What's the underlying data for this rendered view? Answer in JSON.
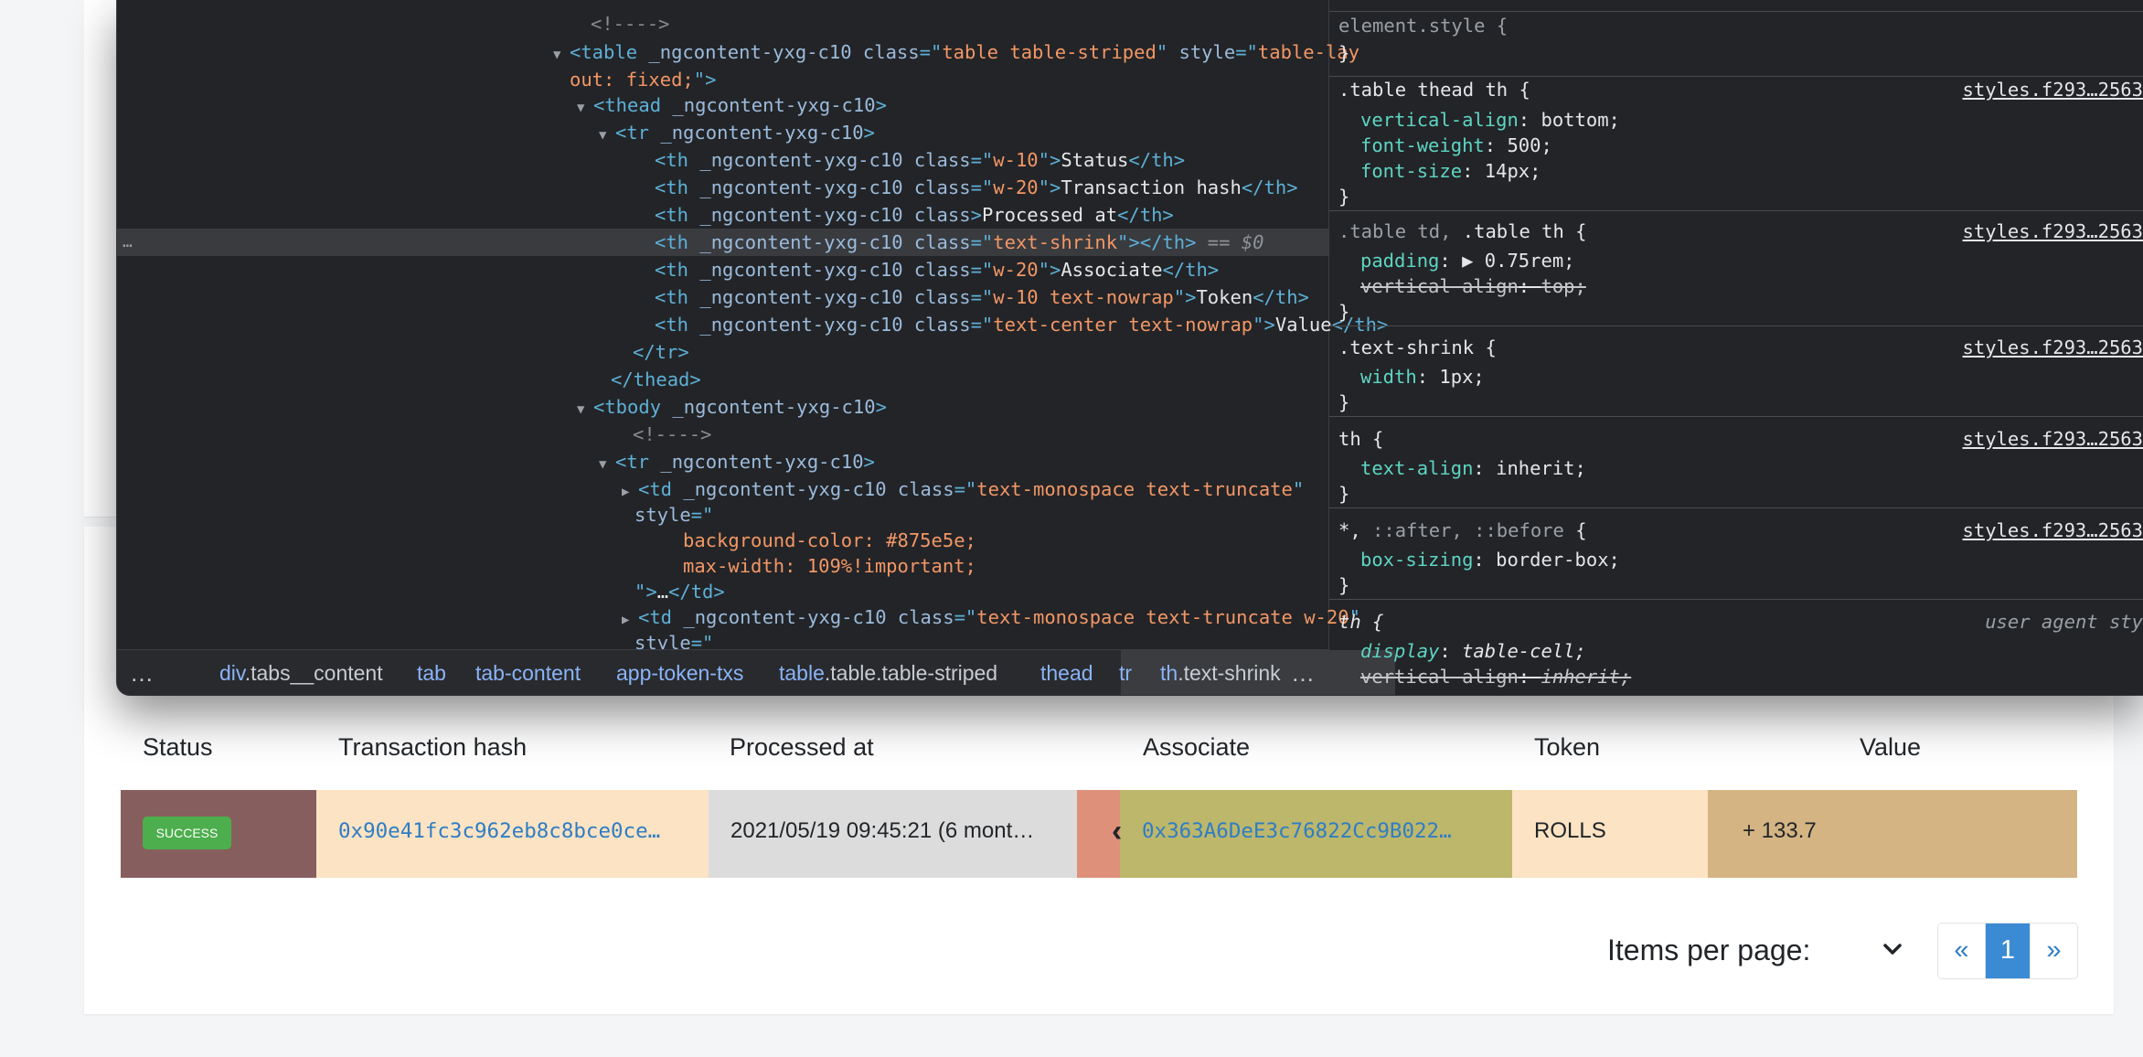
{
  "devtools": {
    "elements_lines": [
      [
        [
          "cm",
          "<!---->"
        ]
      ],
      [
        [
          "tag",
          "<table "
        ],
        [
          "an",
          "_ngcontent-yxg-c10 class"
        ],
        [
          "tag",
          "=\""
        ],
        [
          "av",
          "table table-striped"
        ],
        [
          "tag",
          "\" "
        ],
        [
          "an",
          "style"
        ],
        [
          "tag",
          "=\""
        ],
        [
          "av",
          "table-lay"
        ]
      ],
      [
        [
          "av",
          "out: fixed;"
        ],
        [
          "tag",
          "\">"
        ]
      ],
      [
        [
          "tag",
          "<thead "
        ],
        [
          "an",
          "_ngcontent-yxg-c10"
        ],
        [
          "tag",
          ">"
        ]
      ],
      [
        [
          "tag",
          "<tr "
        ],
        [
          "an",
          "_ngcontent-yxg-c10"
        ],
        [
          "tag",
          ">"
        ]
      ],
      [
        [
          "tag",
          "<th "
        ],
        [
          "an",
          "_ngcontent-yxg-c10 class"
        ],
        [
          "tag",
          "=\""
        ],
        [
          "av",
          "w-10"
        ],
        [
          "tag",
          "\">"
        ],
        [
          "tx",
          "Status"
        ],
        [
          "tag",
          "</th>"
        ]
      ],
      [
        [
          "tag",
          "<th "
        ],
        [
          "an",
          "_ngcontent-yxg-c10 class"
        ],
        [
          "tag",
          "=\""
        ],
        [
          "av",
          "w-20"
        ],
        [
          "tag",
          "\">"
        ],
        [
          "tx",
          "Transaction hash"
        ],
        [
          "tag",
          "</th>"
        ]
      ],
      [
        [
          "tag",
          "<th "
        ],
        [
          "an",
          "_ngcontent-yxg-c10 class"
        ],
        [
          "tag",
          ">"
        ],
        [
          "tx",
          "Processed at"
        ],
        [
          "tag",
          "</th>"
        ]
      ],
      [
        [
          "tag",
          "<th "
        ],
        [
          "an",
          "_ngcontent-yxg-c10 class"
        ],
        [
          "tag",
          "=\""
        ],
        [
          "av",
          "text-shrink"
        ],
        [
          "tag",
          "\"></th>"
        ],
        [
          "dollar",
          " == $0"
        ]
      ],
      [
        [
          "tag",
          "<th "
        ],
        [
          "an",
          "_ngcontent-yxg-c10 class"
        ],
        [
          "tag",
          "=\""
        ],
        [
          "av",
          "w-20"
        ],
        [
          "tag",
          "\">"
        ],
        [
          "tx",
          "Associate"
        ],
        [
          "tag",
          "</th>"
        ]
      ],
      [
        [
          "tag",
          "<th "
        ],
        [
          "an",
          "_ngcontent-yxg-c10 class"
        ],
        [
          "tag",
          "=\""
        ],
        [
          "av",
          "w-10 text-nowrap"
        ],
        [
          "tag",
          "\">"
        ],
        [
          "tx",
          "Token"
        ],
        [
          "tag",
          "</th>"
        ]
      ],
      [
        [
          "tag",
          "<th "
        ],
        [
          "an",
          "_ngcontent-yxg-c10 class"
        ],
        [
          "tag",
          "=\""
        ],
        [
          "av",
          "text-center text-nowrap"
        ],
        [
          "tag",
          "\">"
        ],
        [
          "tx",
          "Value"
        ],
        [
          "tag",
          "</th>"
        ]
      ],
      [
        [
          "tag",
          "</tr>"
        ]
      ],
      [
        [
          "tag",
          "</thead>"
        ]
      ],
      [
        [
          "tag",
          "<tbody "
        ],
        [
          "an",
          "_ngcontent-yxg-c10"
        ],
        [
          "tag",
          ">"
        ]
      ],
      [
        [
          "cm",
          "<!---->"
        ]
      ],
      [
        [
          "tag",
          "<tr "
        ],
        [
          "an",
          "_ngcontent-yxg-c10"
        ],
        [
          "tag",
          ">"
        ]
      ],
      [
        [
          "tag",
          "<td "
        ],
        [
          "an",
          "_ngcontent-yxg-c10 class"
        ],
        [
          "tag",
          "=\""
        ],
        [
          "av",
          "text-monospace text-truncate"
        ],
        [
          "tag",
          "\""
        ]
      ],
      [
        [
          "an",
          "style"
        ],
        [
          "tag",
          "=\""
        ]
      ],
      [
        [
          "av",
          "background-color: #875e5e;"
        ]
      ],
      [
        [
          "av",
          "max-width: 109%!important;"
        ]
      ],
      [
        [
          "tag",
          "\">"
        ],
        [
          "tx",
          "…"
        ],
        [
          "tag",
          "</td>"
        ]
      ],
      [
        [
          "tag",
          "<td "
        ],
        [
          "an",
          "_ngcontent-yxg-c10 class"
        ],
        [
          "tag",
          "=\""
        ],
        [
          "av",
          "text-monospace text-truncate w-20"
        ],
        [
          "tag",
          "\""
        ]
      ],
      [
        [
          "an",
          "style"
        ],
        [
          "tag",
          "=\""
        ]
      ]
    ],
    "selected_line_ellipsis": "…",
    "breadcrumbs": {
      "leading_dots": "…",
      "trailing_dots": "…",
      "items": [
        {
          "tag": "div",
          "cls": ".tabs__content"
        },
        {
          "tag": "tab",
          "cls": ""
        },
        {
          "tag": "tab-content",
          "cls": ""
        },
        {
          "tag": "app-token-txs",
          "cls": ""
        },
        {
          "tag": "table",
          "cls": ".table.table-striped"
        },
        {
          "tag": "thead",
          "cls": ""
        },
        {
          "tag": "tr",
          "cls": ""
        },
        {
          "tag": "th",
          "cls": ".text-shrink"
        }
      ]
    },
    "styles": {
      "element_style": "element.style {",
      "close_brace": "}",
      "rules": [
        {
          "selector": ".table thead th {",
          "source": "styles.f293…2563",
          "props": [
            [
              "vertical-align",
              "bottom;",
              false
            ],
            [
              "font-weight",
              "500;",
              false
            ],
            [
              "font-size",
              "14px;",
              false
            ]
          ]
        },
        {
          "selector_dim": ".table td, ",
          "selector": ".table th {",
          "source": "styles.f293…2563",
          "props": [
            [
              "padding",
              "▶ 0.75rem;",
              false
            ],
            [
              "vertical-align",
              "top;",
              true
            ]
          ]
        },
        {
          "selector": ".text-shrink {",
          "source": "styles.f293…2563",
          "props": [
            [
              "width",
              "1px;",
              false
            ]
          ]
        },
        {
          "selector": "th {",
          "source": "styles.f293…2563",
          "props": [
            [
              "text-align",
              "inherit;",
              false
            ]
          ]
        },
        {
          "selector": "*, ",
          "selector_dim": "::after, ::before",
          "selector_end": " {",
          "source": "styles.f293…2563",
          "props": [
            [
              "box-sizing",
              "border-box;",
              false
            ]
          ]
        },
        {
          "selector": "th {",
          "source": "user agent sty",
          "props": [
            [
              "display",
              "table-cell;",
              false
            ],
            [
              "vertical-align",
              "inherit;",
              true
            ]
          ]
        }
      ]
    }
  },
  "table": {
    "headers": [
      "Status",
      "Transaction hash",
      "Processed at",
      "Associate",
      "Token",
      "Value"
    ],
    "row": {
      "status": "SUCCESS",
      "tx_hash": "0x90e41fc3c962eb8c8bce0ce…",
      "processed_at": "2021/05/19 09:45:21 (6 mont…",
      "expand_icon": "‹",
      "associate": "0x363A6DeE3c76822Cc9B022…",
      "token": "ROLLS",
      "value": "+ 133.7"
    },
    "colors": {
      "status_bg": "#875e5e",
      "hash_bg": "#fbe3c3",
      "processed_bg": "#dcdcdc",
      "shrink_bg": "#de907a",
      "associate_bg": "#bdb76b",
      "token_bg": "#fbe3c3",
      "value_bg": "#d4b483",
      "success": "#4cae4c",
      "link": "#2f7dc4"
    }
  },
  "pagination": {
    "items_per_page_label": "Items per page:",
    "prev": "«",
    "current": "1",
    "next": "»"
  }
}
